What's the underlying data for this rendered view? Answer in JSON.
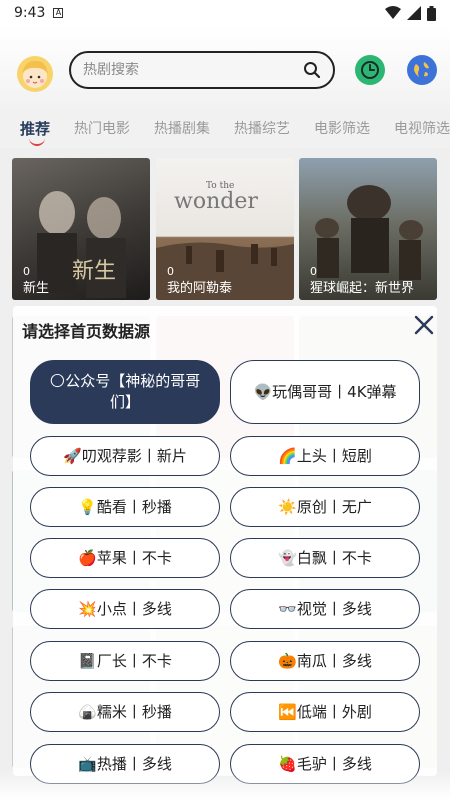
{
  "status_bar": {
    "time": "9:43",
    "notification": "A"
  },
  "search": {
    "placeholder": "热剧搜索"
  },
  "tabs": [
    "推荐",
    "热门电影",
    "热播剧集",
    "热播综艺",
    "电影筛选",
    "电视筛选"
  ],
  "cards": [
    {
      "count": "0",
      "title": "新生"
    },
    {
      "count": "0",
      "title": "我的阿勒泰"
    },
    {
      "count": "0",
      "title": "猩球崛起：新世界"
    }
  ],
  "dialog": {
    "title": "请选择首页数据源",
    "options": [
      "🌕公众号【神秘的哥哥们】",
      "👽玩偶哥哥丨4K弹幕",
      "🚀叨观荐影丨新片",
      "🌈上头丨短剧",
      "💡酷看丨秒播",
      "☀️原创丨无广",
      "🍎苹果丨不卡",
      "👻白飘丨不卡",
      "💥小点丨多线",
      "👓视觉丨多线",
      "📓厂长丨不卡",
      "🎃南瓜丨多线",
      "🍙糯米丨秒播",
      "⏮️低端丨外剧",
      "📺热播丨多线",
      "🍓毛驴丨多线"
    ]
  },
  "colors": {
    "accent": "#2a3a58",
    "tab_active": "#2a3f5f",
    "underline": "#e04040",
    "history_green": "#2bb673",
    "globe_blue": "#3d73d8"
  }
}
